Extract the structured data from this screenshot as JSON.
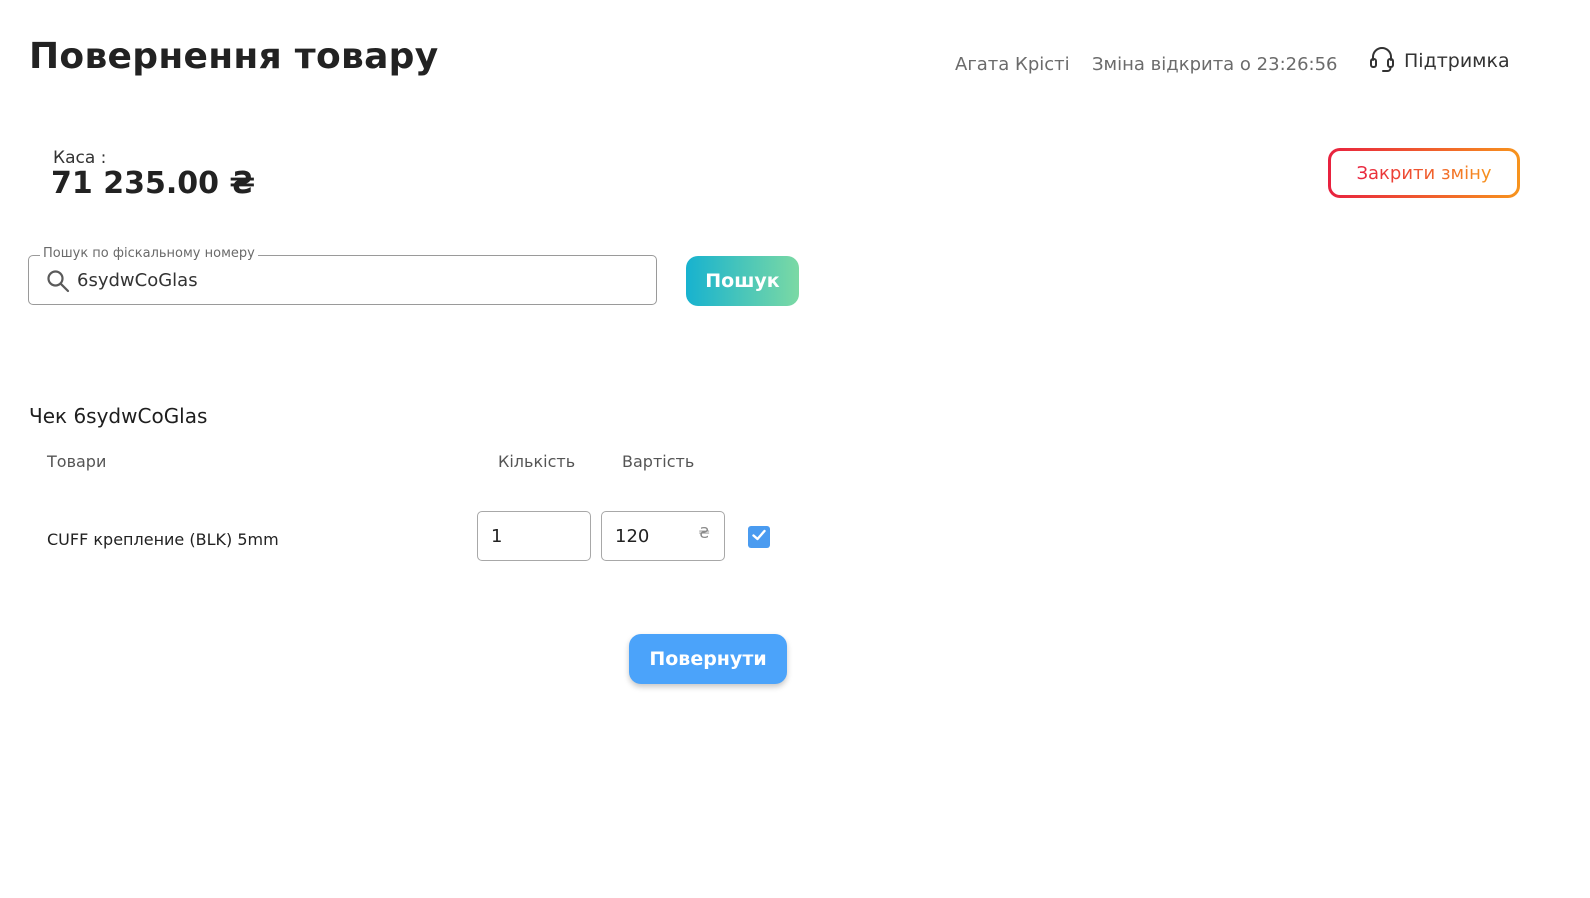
{
  "header": {
    "title": "Повернення товару",
    "user_name": "Агата Крісті",
    "shift_status": "Зміна відкрита о 23:26:56",
    "support_label": "Підтримка",
    "support_icon": "headset-icon"
  },
  "cash": {
    "label": "Каса :",
    "amount": "71 235.00 ₴"
  },
  "actions": {
    "close_shift_label": "Закрити зміну",
    "close_shift_colors": [
      "#e8213f",
      "#f7941d"
    ]
  },
  "search": {
    "legend": "Пошук по фіскальному номеру",
    "value": "6sydwCoGlas",
    "icon": "search-icon",
    "button_label": "Пошук",
    "button_colors": [
      "#17b2cf",
      "#7bd9a4"
    ]
  },
  "receipt": {
    "title": "Чек 6sydwCoGlas",
    "columns": {
      "goods": "Товари",
      "quantity": "Кількість",
      "price": "Вартість"
    },
    "items": [
      {
        "name": "CUFF крепление (BLK) 5mm",
        "quantity": "1",
        "price": "120",
        "currency": "₴",
        "selected": true
      }
    ],
    "checkbox_color": "#4a9bf0"
  },
  "return_button": {
    "label": "Повернути",
    "color": "#4ba3fa"
  }
}
